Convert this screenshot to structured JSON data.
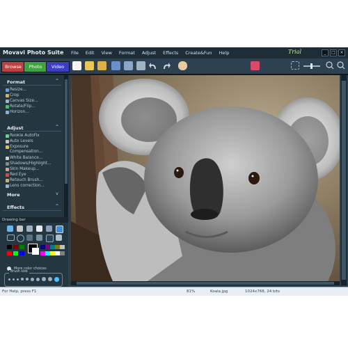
{
  "app": {
    "title": "Movavi Photo Suite",
    "trial_label": "Trial"
  },
  "menu": [
    "File",
    "Edit",
    "View",
    "Format",
    "Adjust",
    "Effects",
    "Create&Fun",
    "Help"
  ],
  "mode_tabs": [
    {
      "label": "Browse",
      "color": "#c23f3f"
    },
    {
      "label": "Photo",
      "color": "#3ea43e"
    },
    {
      "label": "Video",
      "color": "#3e3ec2"
    }
  ],
  "window_buttons": [
    "_",
    "□",
    "×"
  ],
  "toolbar_icons": [
    "new-icon",
    "open-icon",
    "open-folder-icon",
    "save-icon",
    "print-icon",
    "scan-icon",
    "undo-icon",
    "redo-icon",
    "hand-icon",
    "text-tool-icon",
    "fit-icon",
    "zoom-out-icon",
    "zoom-in-icon"
  ],
  "sidebar": {
    "format": {
      "header": "Format",
      "items": [
        "Resize...",
        "Crop",
        "Canvas Size...",
        "Rotate/Flip...",
        "Horizon..."
      ]
    },
    "adjust": {
      "header": "Adjust",
      "items": [
        "Rookie AutoFix",
        "Auto Levels",
        "Exposure Compensation...",
        "White Balance...",
        "Shadows/Highlight...",
        "Skin Makeup...",
        "Red Eye",
        "Retouch Brush...",
        "Lens correction..."
      ],
      "more": "More"
    },
    "effects": {
      "header": "Effects"
    }
  },
  "drawing_bar": {
    "header": "Drawing bar",
    "tools": [
      "text-icon",
      "fill-icon",
      "pen-icon",
      "eraser-icon",
      "brush-icon",
      "color-picker-icon",
      "rect-icon",
      "ellipse-icon",
      "line-icon",
      "shape-icon",
      "gradient-icon",
      "clone-icon"
    ],
    "palette": [
      "#000000",
      "#7f0000",
      "#007f00",
      "#00007f",
      "#7f007f",
      "#007f7f",
      "#7f7f00",
      "#c0c0c0",
      "#ff0000",
      "#00ff00",
      "#0000ff",
      "#ff00ff",
      "#00ffff",
      "#ffff00",
      "#ffffff",
      "#808080"
    ],
    "more_colors": "More color choices",
    "brush_size_label": "Brush size"
  },
  "status": {
    "help": "For Help, press F1",
    "zoom": "81%",
    "filename": "Koala.jpg",
    "dimensions": "1024x768, 24 bits"
  },
  "colors": {
    "window_bg": "#2c3f4c",
    "menu_text": "#cfe3ff",
    "accent_green": "#3ea43e"
  }
}
